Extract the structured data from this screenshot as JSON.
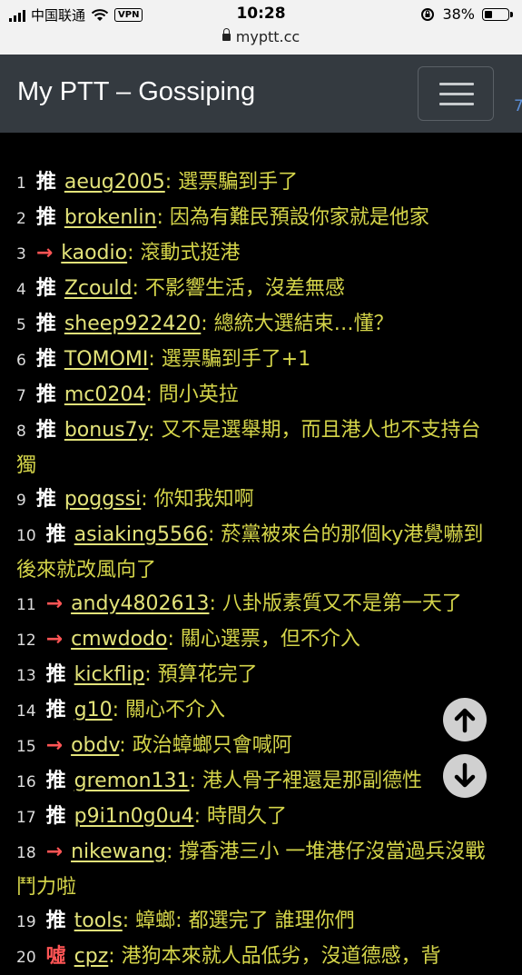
{
  "status_bar": {
    "carrier": "中国联通",
    "vpn": "VPN",
    "time": "10:28",
    "battery": "38%",
    "battery_level": 0.38,
    "url": "myptt.cc"
  },
  "navbar": {
    "brand": "My PTT – Gossiping",
    "menu_icon": "hamburger-icon",
    "edge_text": "7"
  },
  "pushes": [
    {
      "num": "1",
      "tag": "推",
      "type": "push",
      "user": "aeug2005",
      "text": ": 選票騙到手了"
    },
    {
      "num": "2",
      "tag": "推",
      "type": "push",
      "user": "brokenlin",
      "text": ": 因為有難民預設你家就是他家"
    },
    {
      "num": "3",
      "tag": "→",
      "type": "arrow",
      "user": "kaodio",
      "text": ": 滾動式挺港"
    },
    {
      "num": "4",
      "tag": "推",
      "type": "push",
      "user": "Zcould",
      "text": ": 不影響生活，沒差無感"
    },
    {
      "num": "5",
      "tag": "推",
      "type": "push",
      "user": "sheep922420",
      "text": ": 總統大選結束…懂？"
    },
    {
      "num": "6",
      "tag": "推",
      "type": "push",
      "user": "TOMOMI",
      "text": ": 選票騙到手了+1"
    },
    {
      "num": "7",
      "tag": "推",
      "type": "push",
      "user": "mc0204",
      "text": ": 問小英拉"
    },
    {
      "num": "8",
      "tag": "推",
      "type": "push",
      "user": "bonus7y",
      "text": ": 又不是選舉期，而且港人也不支持台獨"
    },
    {
      "num": "9",
      "tag": "推",
      "type": "push",
      "user": "poggssi",
      "text": ": 你知我知啊"
    },
    {
      "num": "10",
      "tag": "推",
      "type": "push",
      "user": "asiaking5566",
      "text": ": 菸黨被來台的那個ky港覺嚇到 後來就改風向了"
    },
    {
      "num": "11",
      "tag": "→",
      "type": "arrow",
      "user": "andy4802613",
      "text": ": 八卦版素質又不是第一天了"
    },
    {
      "num": "12",
      "tag": "→",
      "type": "arrow",
      "user": "cmwdodo",
      "text": ": 關心選票，但不介入"
    },
    {
      "num": "13",
      "tag": "推",
      "type": "push",
      "user": "kickflip",
      "text": ": 預算花完了"
    },
    {
      "num": "14",
      "tag": "推",
      "type": "push",
      "user": "g10",
      "text": ": 關心不介入"
    },
    {
      "num": "15",
      "tag": "→",
      "type": "arrow",
      "user": "obdv",
      "text": ": 政治蟑螂只會喊阿"
    },
    {
      "num": "16",
      "tag": "推",
      "type": "push",
      "user": "gremon131",
      "text": ": 港人骨子裡還是那副德性"
    },
    {
      "num": "17",
      "tag": "推",
      "type": "push",
      "user": "p9i1n0g0u4",
      "text": ": 時間久了"
    },
    {
      "num": "18",
      "tag": "→",
      "type": "arrow",
      "user": "nikewang",
      "text": ": 撐香港三小 一堆港仔沒當過兵沒戰鬥力啦"
    },
    {
      "num": "19",
      "tag": "推",
      "type": "push",
      "user": "tools",
      "text": ": 蟑螂: 都選完了 誰理你們"
    },
    {
      "num": "20",
      "tag": "噓",
      "type": "boo",
      "user": "cpz",
      "text": ": 港狗本來就人品低劣，沒道德感，背"
    }
  ],
  "buttons": {
    "scroll_up_icon": "arrow-up-circle-icon",
    "scroll_down_icon": "arrow-down-circle-icon"
  }
}
